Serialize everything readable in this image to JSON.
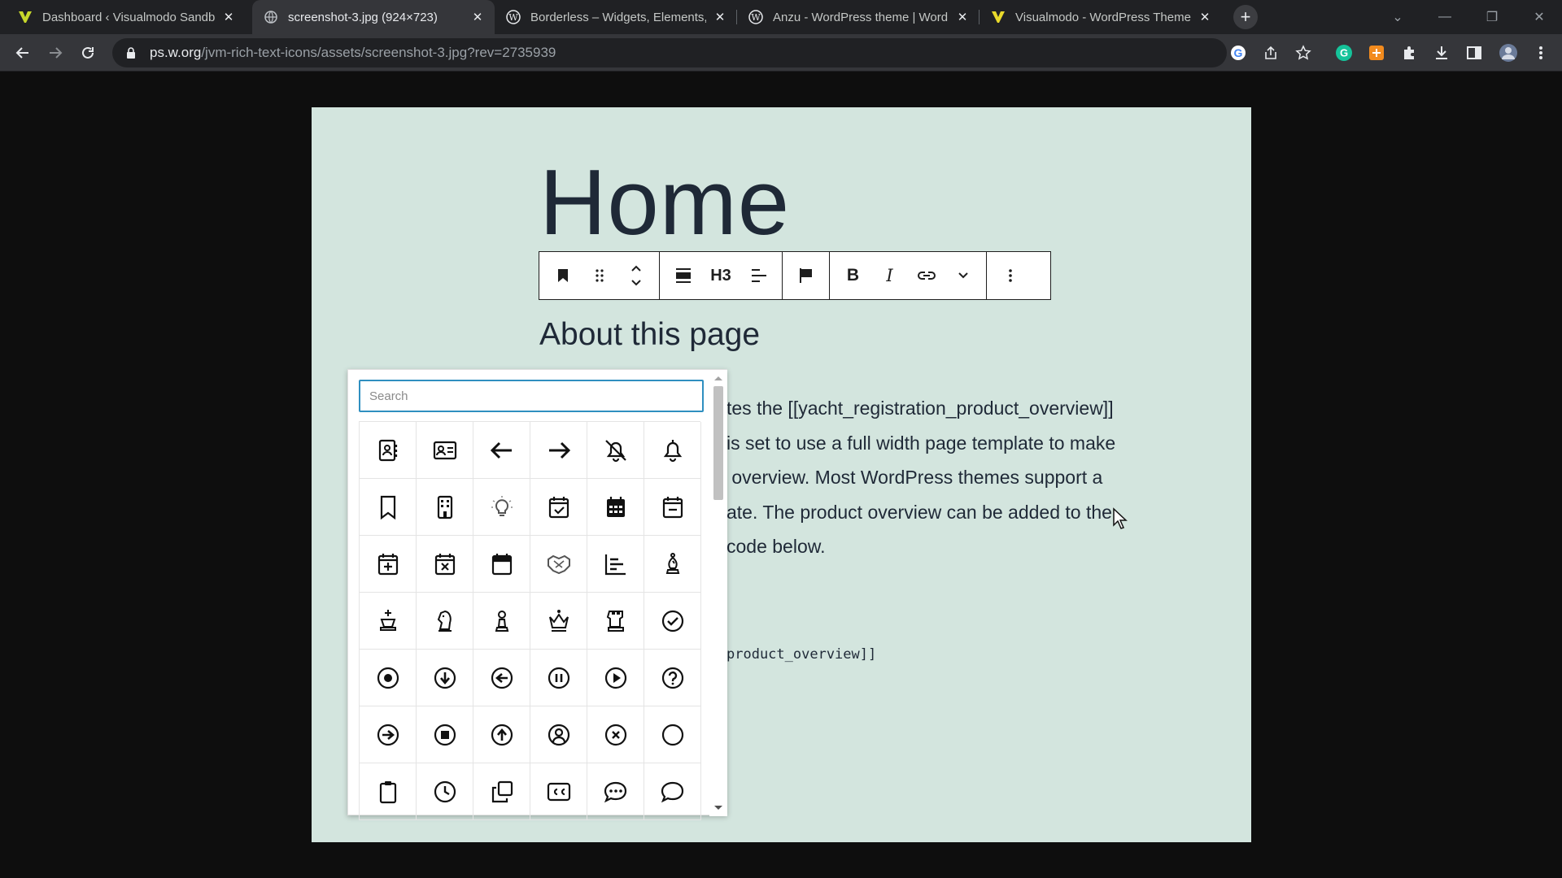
{
  "browser": {
    "tabs": [
      {
        "title": "Dashboard ‹ Visualmodo Sandbox",
        "favicon": "visualmodo-icon",
        "active": false
      },
      {
        "title": "screenshot-3.jpg (924×723)",
        "favicon": "globe-icon",
        "active": true
      },
      {
        "title": "Borderless – Widgets, Elements, T",
        "favicon": "wordpress-icon",
        "active": false
      },
      {
        "title": "Anzu - WordPress theme | WordP",
        "favicon": "wordpress-icon",
        "active": false
      },
      {
        "title": "Visualmodo - WordPress Themes",
        "favicon": "visualmodo-icon",
        "active": false
      }
    ],
    "address": {
      "host": "ps.w.org",
      "path": "/jvm-rich-text-icons/assets/screenshot-3.jpg?rev=2735939"
    }
  },
  "page": {
    "title": "Home",
    "toolbar": {
      "heading_level": "H3",
      "bold_label": "B",
      "italic_label": "I"
    },
    "subheading": "About this page",
    "paragraph": "tes the [[yacht_registration_product_overview]]\nis set to use a full width page template to make\n overview. Most WordPress themes support a\nate. The product overview can be added to the\ncode below.",
    "code": "product_overview]]"
  },
  "icon_picker": {
    "search_placeholder": "Search",
    "icons": [
      "address-book-icon",
      "address-card-icon",
      "arrow-left-icon",
      "arrow-right-icon",
      "bell-slash-icon",
      "bell-icon",
      "bookmark-icon",
      "building-icon",
      "lightbulb-icon",
      "calendar-check-icon",
      "calendar-days-icon",
      "calendar-minus-icon",
      "calendar-plus-icon",
      "calendar-xmark-icon",
      "calendar-icon",
      "handshake-icon",
      "chart-bar-icon",
      "chess-bishop-icon",
      "chess-king-icon",
      "chess-knight-icon",
      "chess-pawn-icon",
      "chess-queen-icon",
      "chess-rook-icon",
      "circle-check-icon",
      "circle-dot-icon",
      "circle-down-icon",
      "circle-left-icon",
      "circle-pause-icon",
      "circle-play-icon",
      "circle-question-icon",
      "circle-right-icon",
      "circle-stop-icon",
      "circle-up-icon",
      "circle-user-icon",
      "circle-xmark-icon",
      "circle-icon",
      "clipboard-icon",
      "clock-icon",
      "clone-icon",
      "closed-captioning-icon",
      "comment-dots-icon",
      "comment-icon"
    ]
  }
}
